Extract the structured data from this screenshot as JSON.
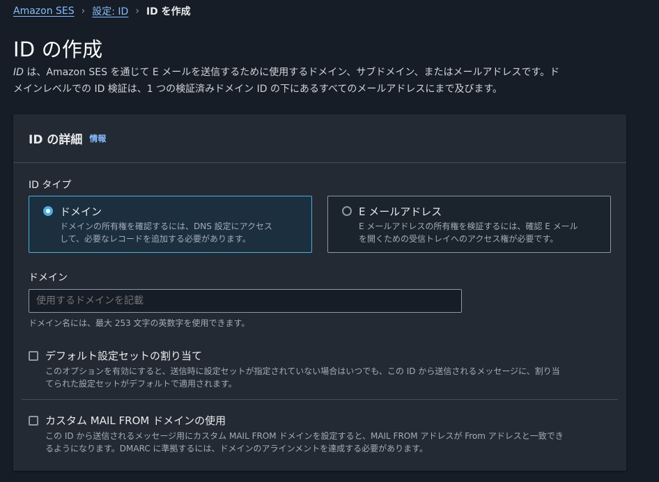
{
  "breadcrumb": {
    "items": [
      {
        "label": "Amazon SES"
      },
      {
        "label": "設定: ID"
      },
      {
        "label": "ID を作成"
      }
    ],
    "separator": "›"
  },
  "page": {
    "title": "ID の作成",
    "description_term": "ID",
    "description_line1": " は、Amazon SES を通じて E メールを送信するために使用するドメイン、サブドメイン、またはメールアドレスです。ド",
    "description_line2": "メインレベルでの ID 検証は、1 つの検証済みドメイン ID の下にあるすべてのメールアドレスにまで及びます。"
  },
  "panel": {
    "title": "ID の詳細",
    "info_link": "情報",
    "identity_type": {
      "label": "ID タイプ",
      "options": [
        {
          "title": "ドメイン",
          "desc_line1": "ドメインの所有権を確認するには、DNS 設定にアクセス",
          "desc_line2": "して、必要なレコードを追加する必要があります。",
          "selected": true
        },
        {
          "title": "E メールアドレス",
          "desc_line1": "E メールアドレスの所有権を検証するには、確認 E メール",
          "desc_line2": "を開くための受信トレイへのアクセス権が必要です。",
          "selected": false
        }
      ]
    },
    "domain": {
      "label": "ドメイン",
      "placeholder": "使用するドメインを記載",
      "value": "",
      "hint": "ドメイン名には、最大 253 文字の英数字を使用できます。"
    },
    "default_config_set": {
      "label": "デフォルト設定セットの割り当て",
      "desc_line1": "このオプションを有効にすると、送信時に設定セットが指定されていない場合はいつでも、この ID から送信されるメッセージに、割り当",
      "desc_line2": "てられた設定セットがデフォルトで適用されます。",
      "checked": false
    },
    "custom_mail_from": {
      "label": "カスタム MAIL FROM ドメインの使用",
      "desc_line1": "この ID から送信されるメッセージ用にカスタム MAIL FROM ドメインを設定すると、MAIL FROM アドレスが From アドレスと一致でき",
      "desc_line2": "るようになります。DMARC に準拠するには、ドメインのアラインメントを達成する必要があります。",
      "checked": false
    }
  },
  "colors": {
    "background": "#161d26",
    "panel": "#232a34",
    "accent": "#4ab0e2",
    "link": "#89bdff"
  }
}
